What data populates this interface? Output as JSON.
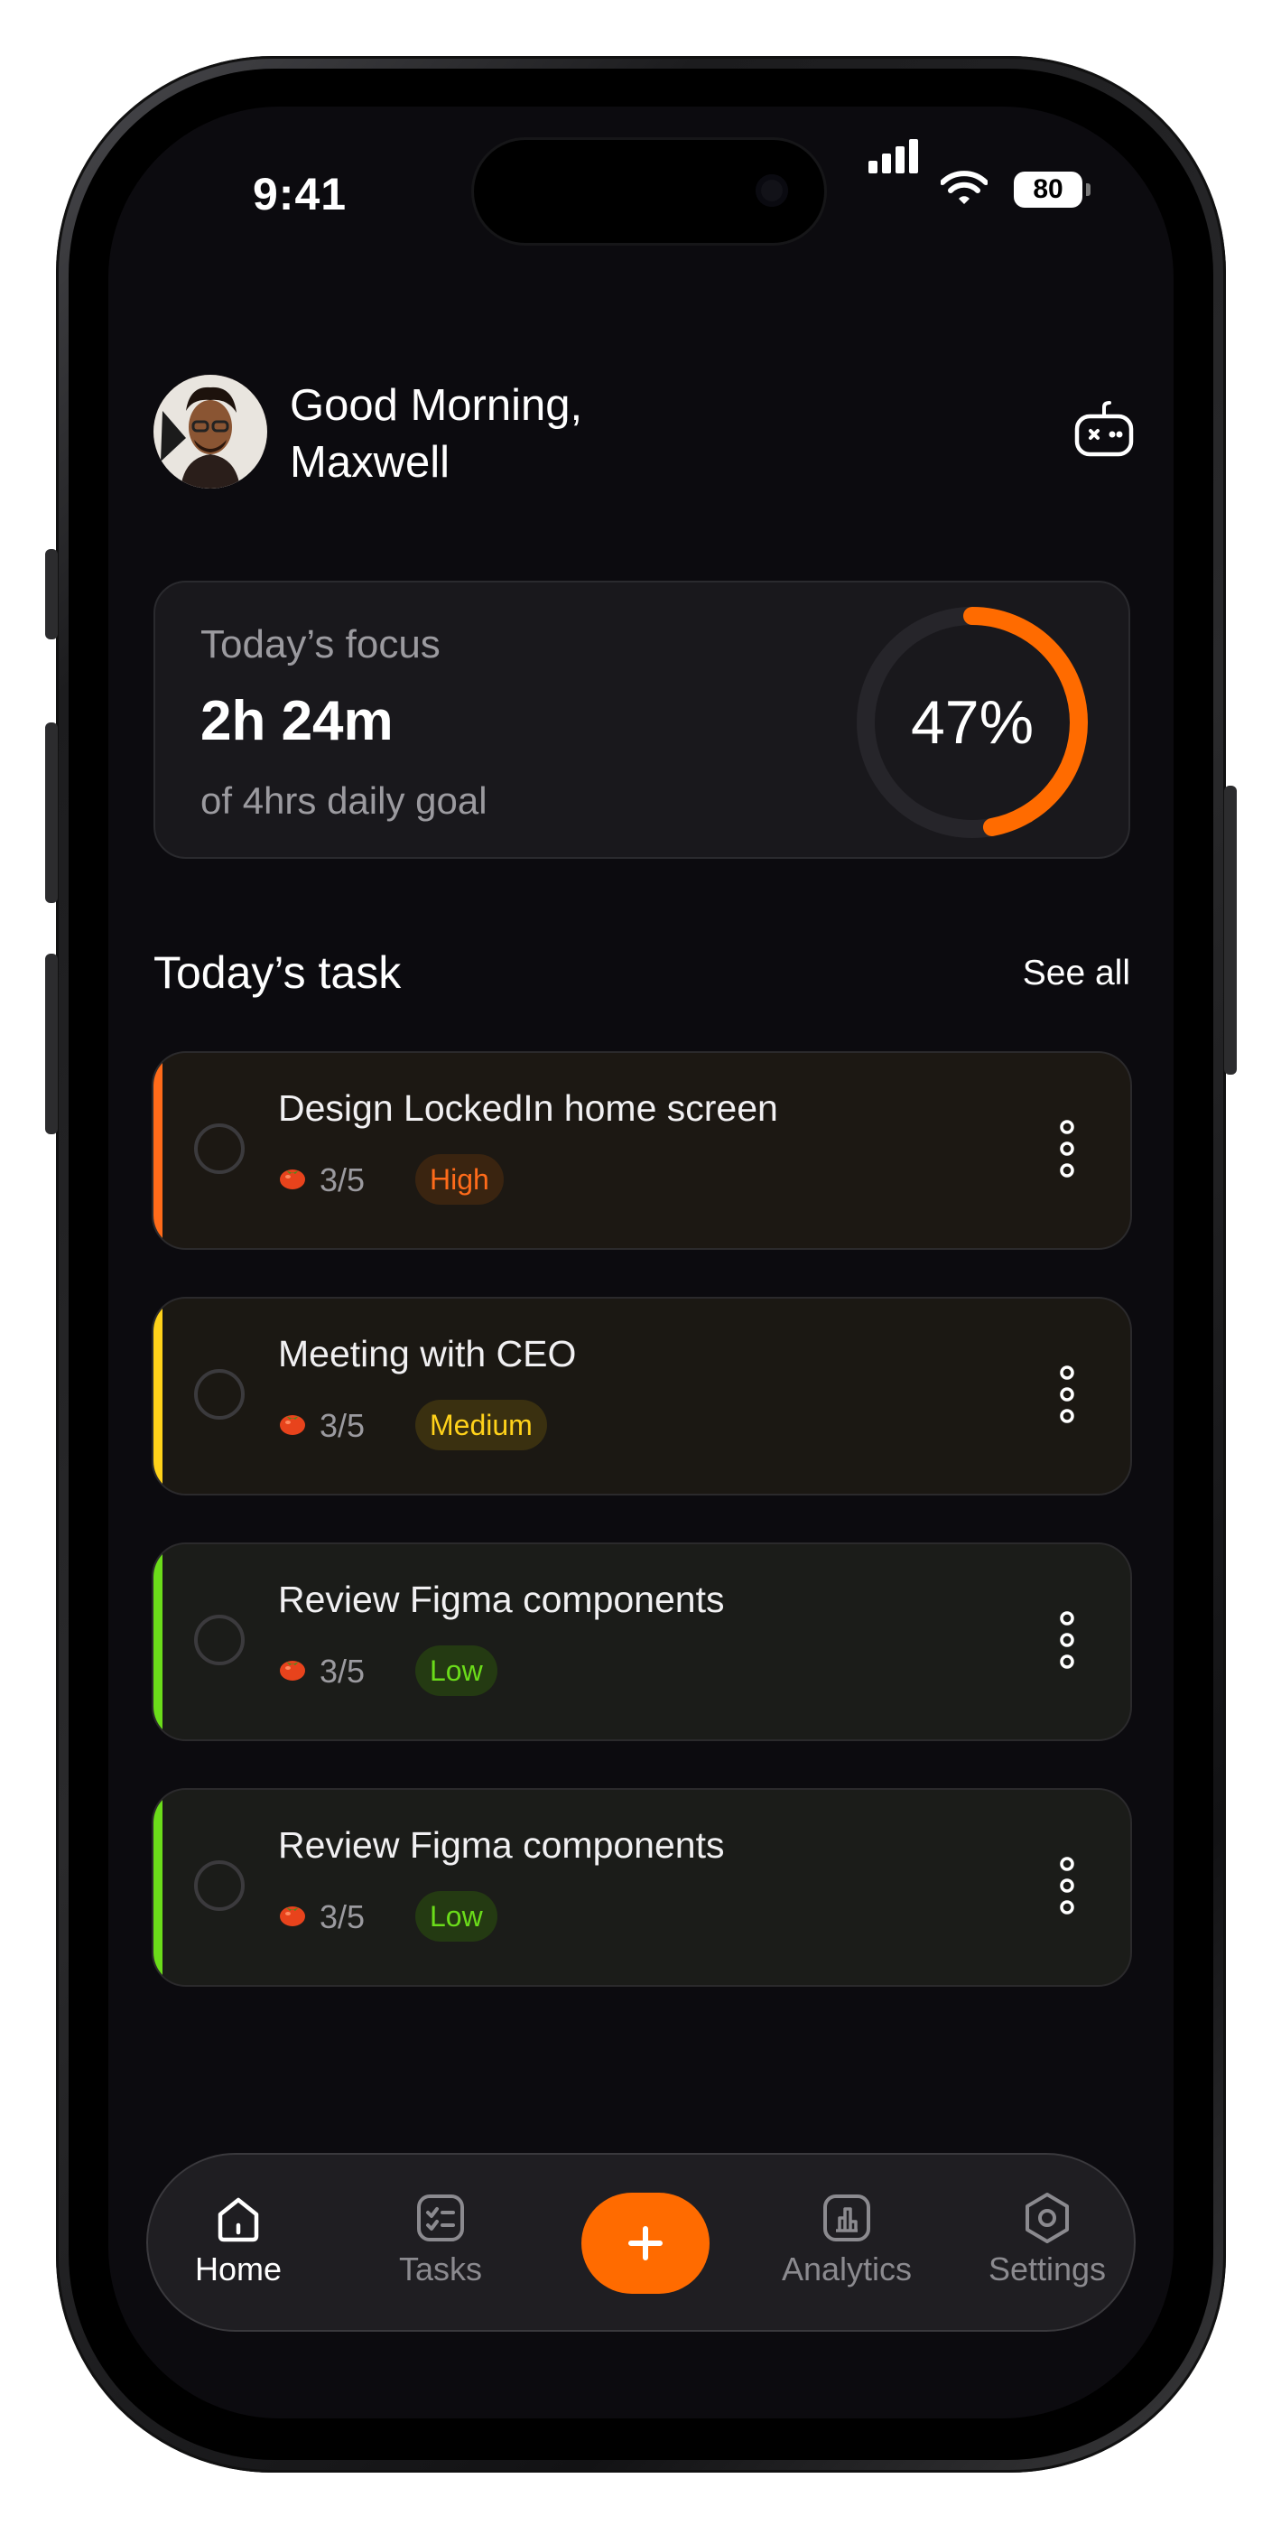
{
  "status_bar": {
    "time": "9:41",
    "battery": "80"
  },
  "header": {
    "greeting_line1": "Good Morning,",
    "greeting_line2": "Maxwell"
  },
  "focus": {
    "label": "Today’s focus",
    "time": "2h 24m",
    "goal": "of 4hrs daily goal",
    "percent_text": "47%",
    "progress": 0.47
  },
  "tasks_section": {
    "title": "Today’s task",
    "see_all": "See all"
  },
  "tasks": [
    {
      "title": "Design LockedIn home screen",
      "count": "3/5",
      "priority": "High",
      "accent": "#ff6b1a"
    },
    {
      "title": "Meeting with CEO",
      "count": "3/5",
      "priority": "Medium",
      "accent": "#ffd21a"
    },
    {
      "title": "Review Figma components",
      "count": "3/5",
      "priority": "Low",
      "accent": "#6bdc1a"
    },
    {
      "title": "Review Figma components",
      "count": "3/5",
      "priority": "Low",
      "accent": "#6bdc1a"
    }
  ],
  "nav": {
    "home": "Home",
    "tasks": "Tasks",
    "analytics": "Analytics",
    "settings": "Settings"
  },
  "colors": {
    "accent": "#ff6b00",
    "high": "#ff6b1a",
    "medium": "#ffd21a",
    "low": "#6bdc1a"
  },
  "icons": [
    "gamepad-icon",
    "tomato-icon",
    "more-vertical-icon",
    "home-icon",
    "tasks-icon",
    "plus-icon",
    "analytics-icon",
    "settings-icon",
    "signal-icon",
    "wifi-icon",
    "battery-icon"
  ]
}
